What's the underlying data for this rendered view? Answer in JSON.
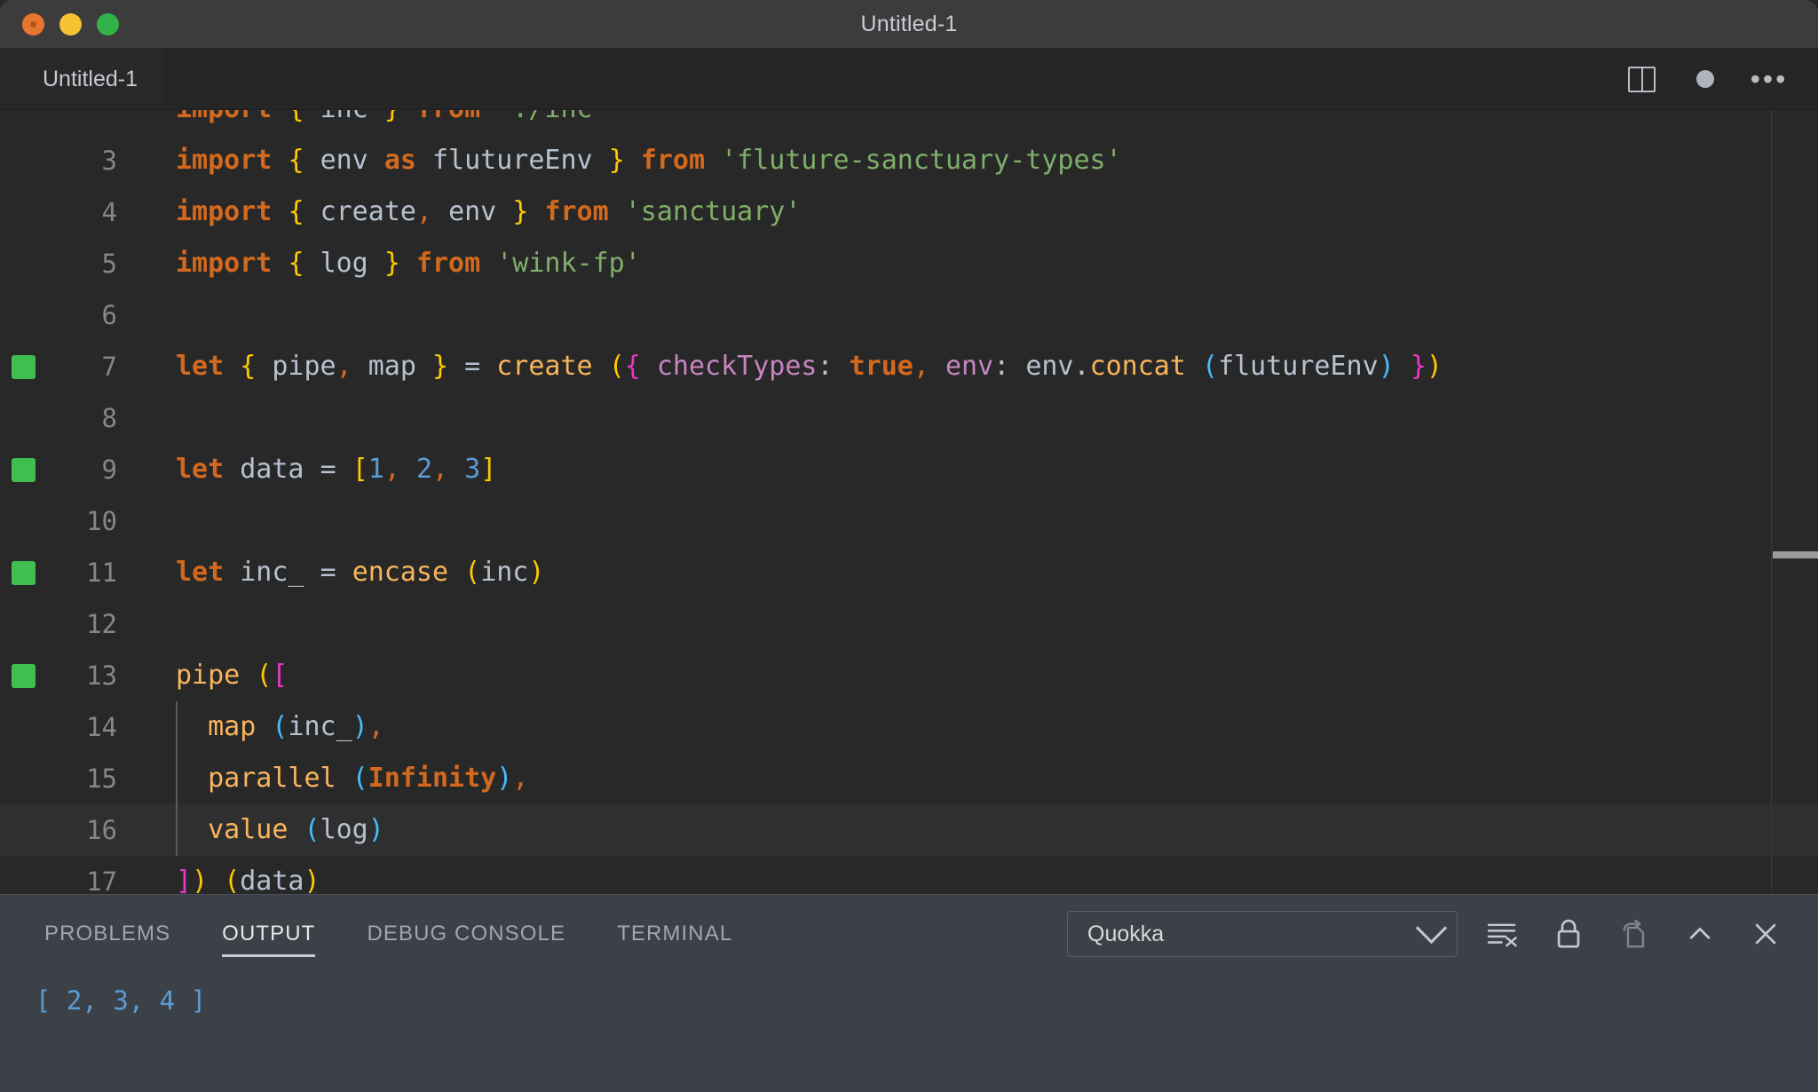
{
  "window": {
    "title": "Untitled-1",
    "traffic_lights": [
      "close-button",
      "minimize-button",
      "maximize-button"
    ]
  },
  "tabbar": {
    "tab_label": "Untitled-1",
    "actions": [
      "split-editor-icon",
      "unsaved-dot-icon",
      "more-actions-icon"
    ]
  },
  "editor": {
    "language": "javascript",
    "lines": [
      {
        "num": "3",
        "marker": false,
        "current": false
      },
      {
        "num": "4",
        "marker": false,
        "current": false
      },
      {
        "num": "5",
        "marker": false,
        "current": false
      },
      {
        "num": "6",
        "marker": false,
        "current": false
      },
      {
        "num": "7",
        "marker": true,
        "current": false
      },
      {
        "num": "8",
        "marker": false,
        "current": false
      },
      {
        "num": "9",
        "marker": true,
        "current": false
      },
      {
        "num": "10",
        "marker": false,
        "current": false
      },
      {
        "num": "11",
        "marker": true,
        "current": false
      },
      {
        "num": "12",
        "marker": false,
        "current": false
      },
      {
        "num": "13",
        "marker": true,
        "current": false
      },
      {
        "num": "14",
        "marker": false,
        "current": false
      },
      {
        "num": "15",
        "marker": false,
        "current": false
      },
      {
        "num": "16",
        "marker": false,
        "current": true
      },
      {
        "num": "17",
        "marker": false,
        "current": false
      }
    ],
    "text": {
      "l3": "import { env as flutureEnv } from 'fluture-sanctuary-types'",
      "l4": "import { create, env } from 'sanctuary'",
      "l5": "import { log } from 'wink-fp'",
      "l7": "let { pipe, map } = create ({ checkTypes: true, env: env.concat (flutureEnv) })",
      "l9": "let data = [1, 2, 3]",
      "l11": "let inc_ = encase (inc)",
      "l13": "pipe ([",
      "l14": "  map (inc_),",
      "l15": "  parallel (Infinity),",
      "l16": "  value (log)",
      "l17": "]) (data)"
    },
    "tokens": {
      "kw_import": "import",
      "kw_let": "let",
      "kw_as": "as",
      "kw_from": "from",
      "brace_open": "{",
      "brace_close": "}",
      "paren_open": "(",
      "paren_close": ")",
      "bracket_open": "[",
      "bracket_close": "]",
      "comma": ",",
      "equals": "=",
      "colon": ":",
      "dot": ".",
      "id_env": "env",
      "id_flutureEnv": "flutureEnv",
      "id_create": "create",
      "id_log": "log",
      "id_pipe": "pipe",
      "id_map": "map",
      "id_data": "data",
      "id_inc_": "inc_",
      "id_inc": "inc",
      "id_encase": "encase",
      "id_concat": "concat",
      "id_parallel": "parallel",
      "id_value": "value",
      "prop_checkTypes": "checkTypes",
      "lit_true": "true",
      "lit_infinity": "Infinity",
      "num_1": "1",
      "num_2": "2",
      "num_3": "3",
      "str_fluture": "'fluture-sanctuary-types'",
      "str_sanctuary": "'sanctuary'",
      "str_winkfp": "'wink-fp'"
    },
    "colors": {
      "background": "#282828",
      "keyword": "#d2691e",
      "function": "#f8b55c",
      "identifier": "#b6c2cf",
      "string": "#7fae6a",
      "number": "#5b9bd5",
      "property": "#c586c0",
      "bracket_level1": "#ffc800",
      "bracket_level2": "#e838c8",
      "bracket_level3": "#46bdff",
      "quokka_marker": "#3fbf4f",
      "line_number": "#868686"
    }
  },
  "panel": {
    "tabs": [
      {
        "label": "PROBLEMS",
        "active": false
      },
      {
        "label": "OUTPUT",
        "active": true
      },
      {
        "label": "DEBUG CONSOLE",
        "active": false
      },
      {
        "label": "TERMINAL",
        "active": false
      }
    ],
    "channel_select": {
      "value": "Quokka",
      "icon": "chevron-down-icon"
    },
    "actions": [
      "clear-output-icon",
      "lock-scroll-icon",
      "open-in-editor-icon",
      "maximize-panel-icon",
      "close-panel-icon"
    ],
    "output": "[ 2, 3, 4 ]"
  }
}
